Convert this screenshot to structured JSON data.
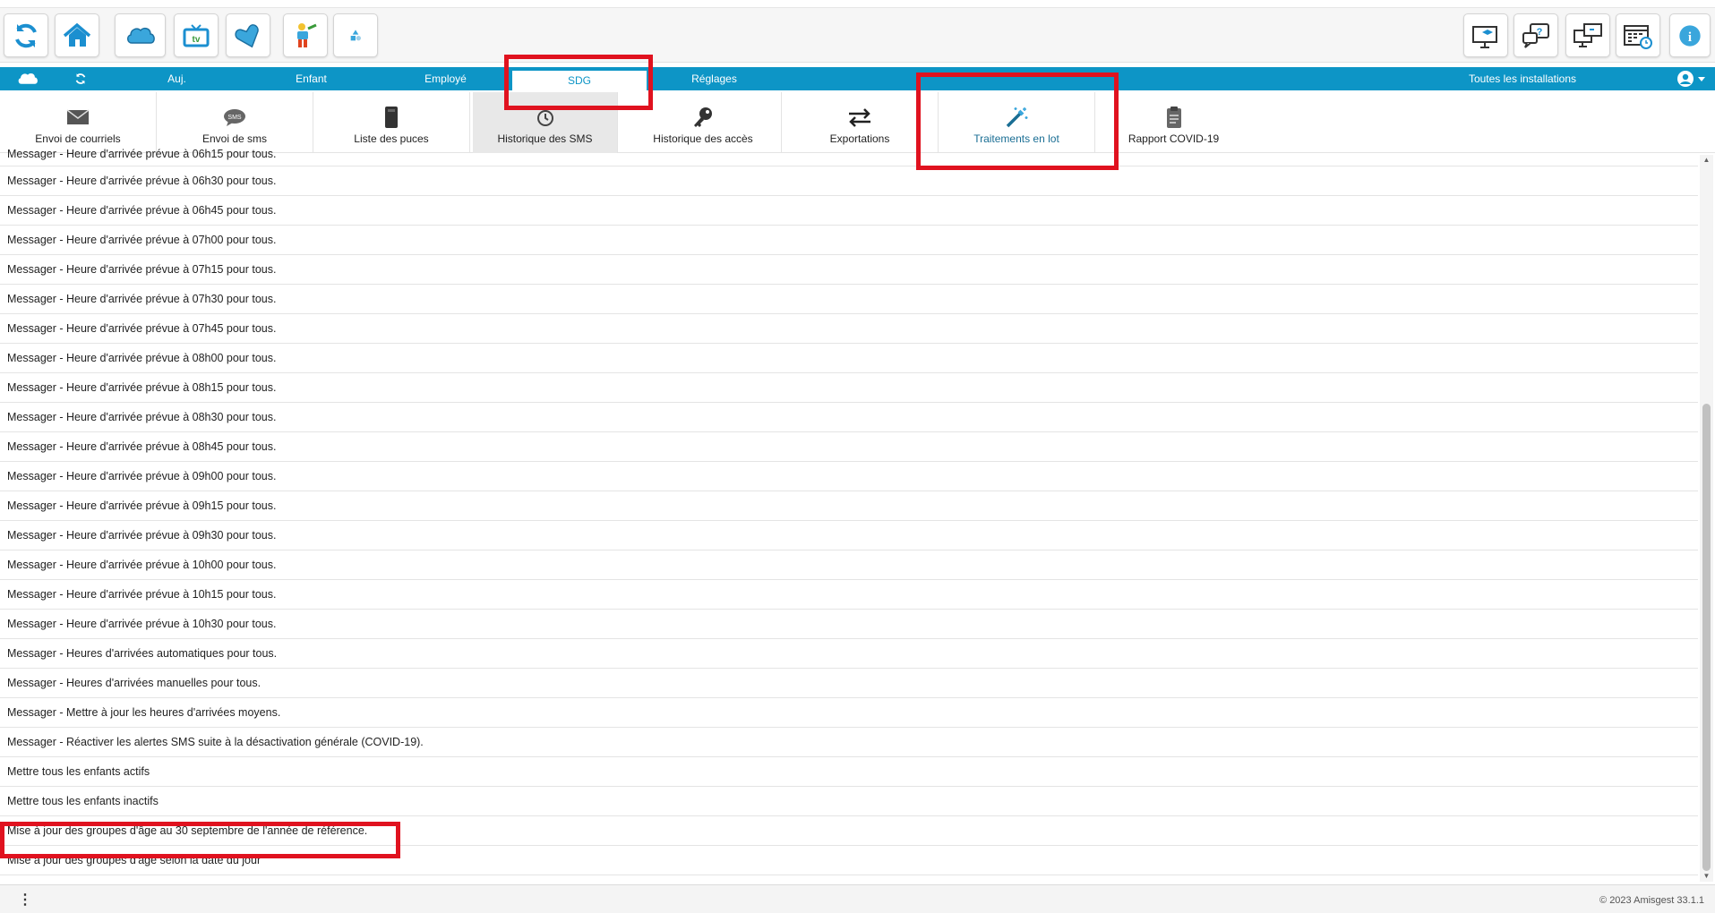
{
  "toolbar": {
    "left_buttons": [
      {
        "icon": "refresh-icon"
      },
      {
        "icon": "home-icon"
      },
      {
        "icon": "cloud-icon"
      },
      {
        "icon": "tv-icon"
      },
      {
        "icon": "heart-icon"
      },
      {
        "icon": "child-toy-icon"
      },
      {
        "icon": "shapes-icon"
      }
    ],
    "right_buttons": [
      {
        "icon": "monitor-training-icon"
      },
      {
        "icon": "help-chat-icon"
      },
      {
        "icon": "remote-screen-icon"
      },
      {
        "icon": "calendar-icon"
      },
      {
        "icon": "info-icon"
      }
    ]
  },
  "nav": {
    "items": [
      "Auj.",
      "Enfant",
      "Employé",
      "SDG",
      "Réglages"
    ],
    "active": "SDG",
    "installations": "Toutes les installations"
  },
  "subtabs": [
    {
      "label": "Envoi de courriels",
      "icon": "envelope-icon"
    },
    {
      "label": "Envoi de sms",
      "icon": "sms-bubble-icon"
    },
    {
      "label": "Liste des puces",
      "icon": "sim-chip-icon"
    },
    {
      "label": "Historique des SMS",
      "icon": "clock-history-icon"
    },
    {
      "label": "Historique des accès",
      "icon": "key-icon"
    },
    {
      "label": "Exportations",
      "icon": "exchange-arrows-icon"
    },
    {
      "label": "Traitements en lot",
      "icon": "magic-wand-icon"
    },
    {
      "label": "Rapport COVID-19",
      "icon": "clipboard-icon"
    }
  ],
  "rows": [
    "Messager - Heure d'arrivée prévue à 06h15 pour tous.",
    "Messager - Heure d'arrivée prévue à 06h30 pour tous.",
    "Messager - Heure d'arrivée prévue à 06h45 pour tous.",
    "Messager - Heure d'arrivée prévue à 07h00 pour tous.",
    "Messager - Heure d'arrivée prévue à 07h15 pour tous.",
    "Messager - Heure d'arrivée prévue à 07h30 pour tous.",
    "Messager - Heure d'arrivée prévue à 07h45 pour tous.",
    "Messager - Heure d'arrivée prévue à 08h00 pour tous.",
    "Messager - Heure d'arrivée prévue à 08h15 pour tous.",
    "Messager - Heure d'arrivée prévue à 08h30 pour tous.",
    "Messager - Heure d'arrivée prévue à 08h45 pour tous.",
    "Messager - Heure d'arrivée prévue à 09h00 pour tous.",
    "Messager - Heure d'arrivée prévue à 09h15 pour tous.",
    "Messager - Heure d'arrivée prévue à 09h30 pour tous.",
    "Messager - Heure d'arrivée prévue à 10h00 pour tous.",
    "Messager - Heure d'arrivée prévue à 10h15 pour tous.",
    "Messager - Heure d'arrivée prévue à 10h30 pour tous.",
    "Messager - Heures d'arrivées automatiques pour tous.",
    "Messager - Heures d'arrivées manuelles pour tous.",
    "Messager - Mettre à jour les heures d'arrivées moyens.",
    "Messager - Réactiver les alertes SMS suite à la désactivation générale (COVID-19).",
    "Mettre tous les enfants actifs",
    "Mettre tous les enfants inactifs",
    "Mise à jour des groupes d'âge au 30 septembre de l'année de référence.",
    "Mise à jour des groupes d'âge selon la date du jour"
  ],
  "footer": {
    "menu": "⋮",
    "copyright": "© 2023 Amisgest 33.1.1"
  },
  "colors": {
    "nav_blue": "#0d95c6",
    "highlight_red": "#e0121f",
    "selected_tab_bg": "#e8e8e8"
  }
}
